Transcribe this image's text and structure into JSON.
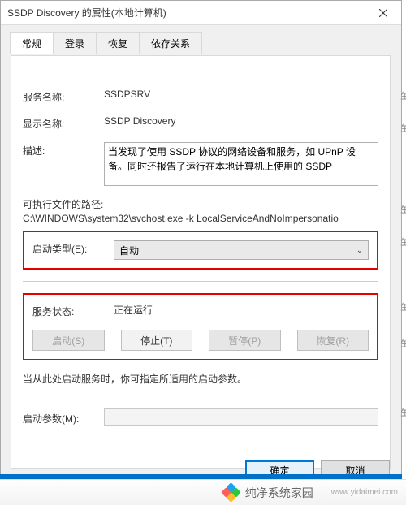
{
  "titlebar": {
    "title": "SSDP Discovery 的属性(本地计算机)"
  },
  "tabs": {
    "general": "常规",
    "logon": "登录",
    "recovery": "恢复",
    "dependencies": "依存关系"
  },
  "fields": {
    "service_name_label": "服务名称:",
    "service_name_value": "SSDPSRV",
    "display_name_label": "显示名称:",
    "display_name_value": "SSDP Discovery",
    "description_label": "描述:",
    "description_value": "当发现了使用 SSDP 协议的网络设备和服务，如 UPnP 设备。同时还报告了运行在本地计算机上使用的 SSDP",
    "exe_path_label": "可执行文件的路径:",
    "exe_path_value": "C:\\WINDOWS\\system32\\svchost.exe -k LocalServiceAndNoImpersonatio",
    "startup_type_label": "启动类型(E):",
    "startup_type_value": "自动",
    "service_status_label": "服务状态:",
    "service_status_value": "正在运行",
    "note_text": "当从此处启动服务时，你可指定所适用的启动参数。",
    "start_params_label": "启动参数(M):",
    "start_params_value": ""
  },
  "buttons": {
    "start": "启动(S)",
    "stop": "停止(T)",
    "pause": "暂停(P)",
    "resume": "恢复(R)",
    "ok": "确定",
    "cancel": "取消"
  },
  "watermark": {
    "text": "纯净系统家园",
    "url": "www.yidaimei.com"
  }
}
